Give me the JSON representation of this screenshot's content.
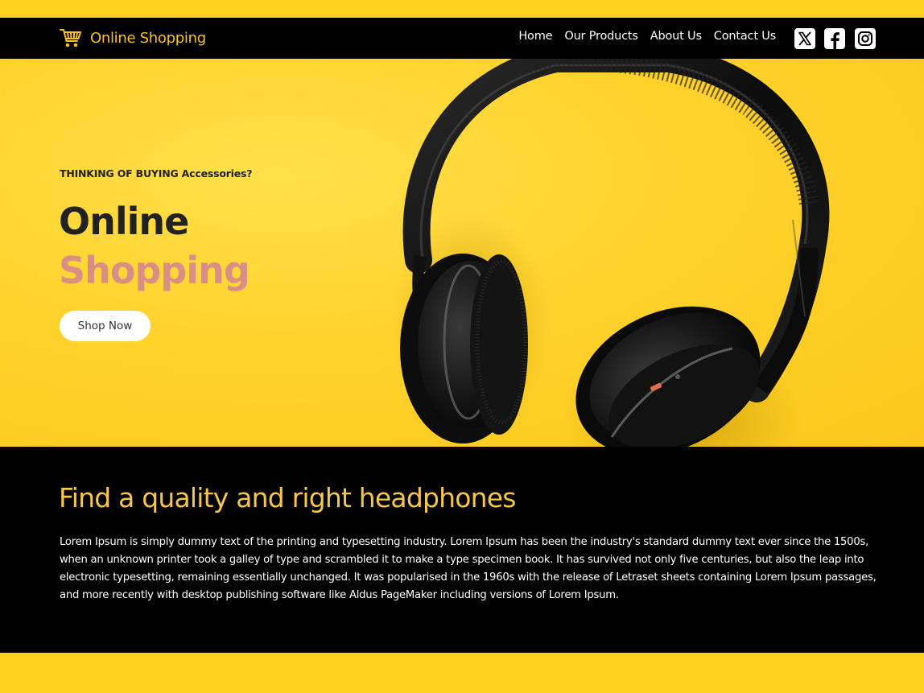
{
  "brand": {
    "name": "Online Shopping",
    "icon": "shopping-cart-icon",
    "color": "#f7c21b"
  },
  "nav": {
    "links": [
      "Home",
      "Our Products",
      "About Us",
      "Contact Us"
    ],
    "social": [
      "x-twitter-icon",
      "facebook-icon",
      "instagram-icon"
    ]
  },
  "hero": {
    "kicker": "THINKING OF BUYING Accessories?",
    "title_line1": "Online",
    "title_line2": "Shopping",
    "accent_color": "#d98f86",
    "button": "Shop Now",
    "image": "headphones-photo"
  },
  "info": {
    "heading": "Find a quality and right headphones",
    "body": "Lorem Ipsum is simply dummy text of the printing and typesetting industry. Lorem Ipsum has been the industry's standard dummy text ever since the 1500s, when an unknown printer took a galley of type and scrambled it to make a type specimen book. It has survived not only five centuries, but also the leap into electronic typesetting, remaining essentially unchanged. It was popularised in the 1960s with the release of Letraset sheets containing Lorem Ipsum passages, and more recently with desktop publishing software like Aldus PageMaker including versions of Lorem Ipsum."
  },
  "colors": {
    "page_bg": "#ffd21f",
    "navbar_bg": "#000000",
    "heading_gold": "#f5c64a"
  }
}
